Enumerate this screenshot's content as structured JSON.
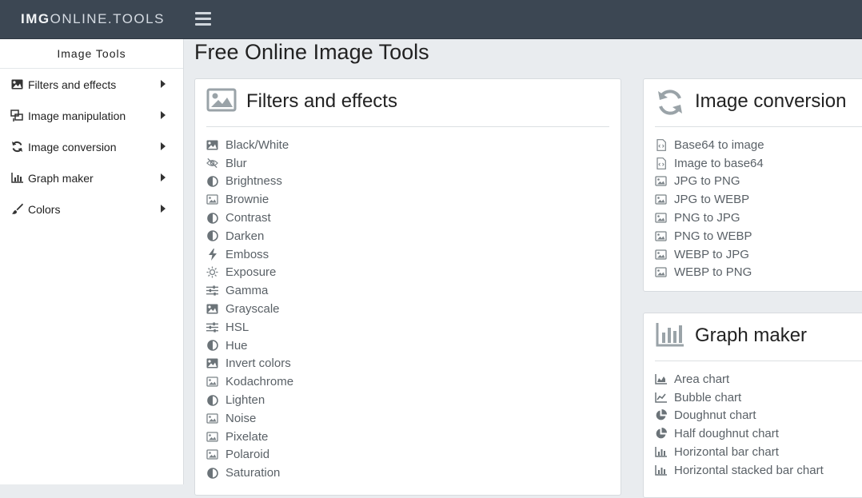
{
  "header": {
    "brand_bold": "IMG",
    "brand_rest": "ONLINE.TOOLS"
  },
  "sidebar": {
    "title": "Image Tools",
    "items": [
      {
        "label": "Filters and effects",
        "icon": "image-icon"
      },
      {
        "label": "Image manipulation",
        "icon": "crop-icon"
      },
      {
        "label": "Image conversion",
        "icon": "sync-icon"
      },
      {
        "label": "Graph maker",
        "icon": "bar-chart-icon"
      },
      {
        "label": "Colors",
        "icon": "brush-icon"
      }
    ]
  },
  "main": {
    "title": "Free Online Image Tools",
    "filters_card": {
      "title": "Filters and effects",
      "items": [
        {
          "label": "Black/White",
          "icon": "image-icon"
        },
        {
          "label": "Blur",
          "icon": "eye-slash-icon"
        },
        {
          "label": "Brightness",
          "icon": "half-circle-icon"
        },
        {
          "label": "Brownie",
          "icon": "image-outline-icon"
        },
        {
          "label": "Contrast",
          "icon": "half-circle-icon"
        },
        {
          "label": "Darken",
          "icon": "half-circle-icon"
        },
        {
          "label": "Emboss",
          "icon": "bolt-icon"
        },
        {
          "label": "Exposure",
          "icon": "sun-icon"
        },
        {
          "label": "Gamma",
          "icon": "sliders-icon"
        },
        {
          "label": "Grayscale",
          "icon": "image-icon"
        },
        {
          "label": "HSL",
          "icon": "sliders-icon"
        },
        {
          "label": "Hue",
          "icon": "half-circle-icon"
        },
        {
          "label": "Invert colors",
          "icon": "image-icon"
        },
        {
          "label": "Kodachrome",
          "icon": "image-outline-icon"
        },
        {
          "label": "Lighten",
          "icon": "half-circle-icon"
        },
        {
          "label": "Noise",
          "icon": "image-outline-icon"
        },
        {
          "label": "Pixelate",
          "icon": "image-outline-icon"
        },
        {
          "label": "Polaroid",
          "icon": "image-outline-icon"
        },
        {
          "label": "Saturation",
          "icon": "half-circle-icon"
        }
      ]
    },
    "conversion_card": {
      "title": "Image conversion",
      "items": [
        {
          "label": "Base64 to image",
          "icon": "file-code-icon"
        },
        {
          "label": "Image to base64",
          "icon": "file-code-icon"
        },
        {
          "label": "JPG to PNG",
          "icon": "image-outline-icon"
        },
        {
          "label": "JPG to WEBP",
          "icon": "image-outline-icon"
        },
        {
          "label": "PNG to JPG",
          "icon": "image-outline-icon"
        },
        {
          "label": "PNG to WEBP",
          "icon": "image-outline-icon"
        },
        {
          "label": "WEBP to JPG",
          "icon": "image-outline-icon"
        },
        {
          "label": "WEBP to PNG",
          "icon": "image-outline-icon"
        }
      ]
    },
    "graph_card": {
      "title": "Graph maker",
      "items": [
        {
          "label": "Area chart",
          "icon": "area-chart-icon"
        },
        {
          "label": "Bubble chart",
          "icon": "line-chart-icon"
        },
        {
          "label": "Doughnut chart",
          "icon": "pie-chart-icon"
        },
        {
          "label": "Half doughnut chart",
          "icon": "pie-chart-icon"
        },
        {
          "label": "Horizontal bar chart",
          "icon": "bar-chart-icon"
        },
        {
          "label": "Horizontal stacked bar chart",
          "icon": "bar-chart-icon"
        }
      ]
    }
  }
}
